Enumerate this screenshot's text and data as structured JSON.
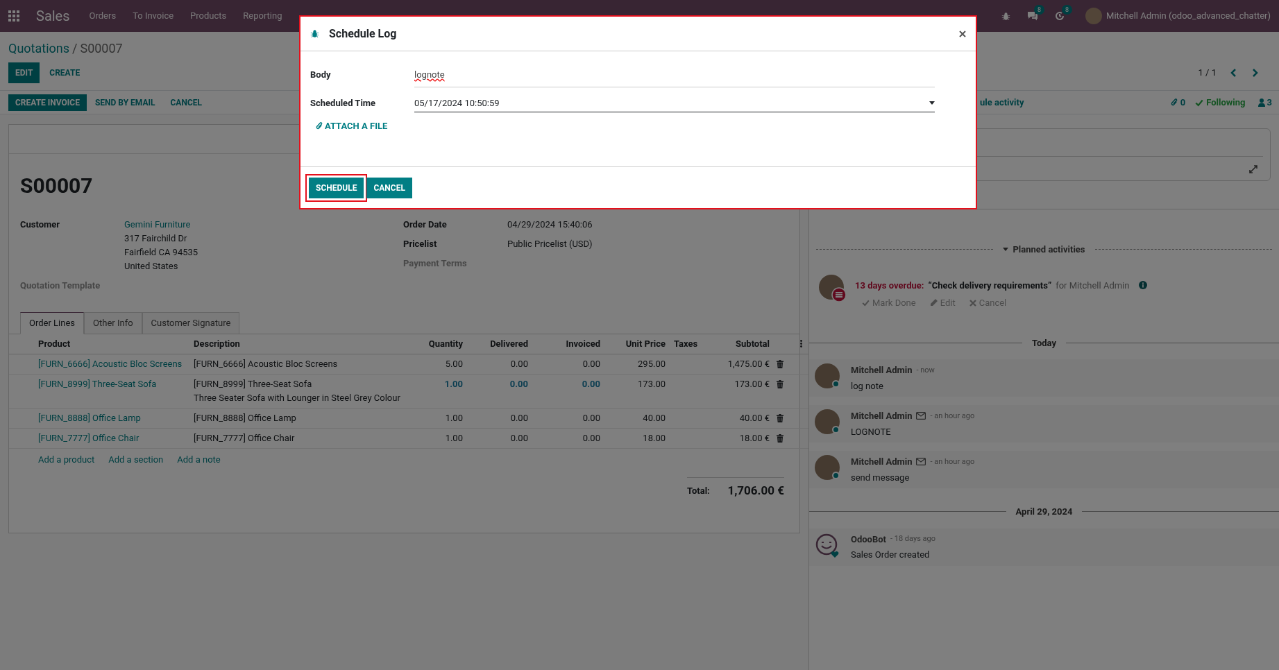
{
  "navbar": {
    "app": "Sales",
    "menu": [
      "Orders",
      "To Invoice",
      "Products",
      "Reporting"
    ],
    "chat_count": "8",
    "activity_count": "8",
    "user": "Mitchell Admin (odoo_advanced_chatter)"
  },
  "breadcrumb": {
    "parent": "Quotations",
    "separator": "/",
    "current": "S00007"
  },
  "actions": [
    "EDIT",
    "CREATE"
  ],
  "pager": "1 / 1",
  "status_actions": [
    {
      "label": "CREATE INVOICE",
      "primary": true
    },
    {
      "label": "SEND BY EMAIL",
      "primary": false
    },
    {
      "label": "CANCEL",
      "primary": false
    }
  ],
  "chatter_bar": {
    "partial_action": "ule activity",
    "attachments": "0",
    "follow": "Following",
    "followers": "3"
  },
  "form": {
    "name": "S00007",
    "left_fields": [
      {
        "label": "Customer",
        "link": "Gemini Furniture",
        "lines": [
          "317 Fairchild Dr",
          "Fairfield CA 94535",
          "United States"
        ]
      },
      {
        "label": "Quotation Template"
      }
    ],
    "right_fields": [
      {
        "label": "Order Date",
        "lines": [
          "04/29/2024 15:40:06"
        ]
      },
      {
        "label": "Pricelist",
        "lines": [
          "Public Pricelist (USD)"
        ]
      },
      {
        "label": "Payment Terms"
      }
    ],
    "tabs": [
      {
        "label": "Order Lines",
        "selected": true
      },
      {
        "label": "Other Info",
        "selected": false
      },
      {
        "label": "Customer Signature",
        "selected": false
      }
    ],
    "table": {
      "columns": [
        "Product",
        "Description",
        "Quantity",
        "Delivered",
        "Invoiced",
        "Unit Price",
        "Taxes",
        "Subtotal"
      ],
      "rows": [
        {
          "product": "[FURN_6666] Acoustic Bloc Screens",
          "description": [
            "[FURN_6666] Acoustic Bloc Screens"
          ],
          "quantity": "5.00",
          "delivered": "0.00",
          "invoiced": "0.00",
          "unit_price": "295.00",
          "subtotal": "1,475.00 €",
          "highlight": false
        },
        {
          "product": "[FURN_8999] Three-Seat Sofa",
          "description": [
            "[FURN_8999] Three-Seat Sofa",
            "Three Seater Sofa with Lounger in Steel Grey Colour"
          ],
          "quantity": "1.00",
          "delivered": "0.00",
          "invoiced": "0.00",
          "unit_price": "173.00",
          "subtotal": "173.00 €",
          "highlight": true
        },
        {
          "product": "[FURN_8888] Office Lamp",
          "description": [
            "[FURN_8888] Office Lamp"
          ],
          "quantity": "1.00",
          "delivered": "0.00",
          "invoiced": "0.00",
          "unit_price": "40.00",
          "subtotal": "40.00 €",
          "highlight": false
        },
        {
          "product": "[FURN_7777] Office Chair",
          "description": [
            "[FURN_7777] Office Chair"
          ],
          "quantity": "1.00",
          "delivered": "0.00",
          "invoiced": "0.00",
          "unit_price": "18.00",
          "subtotal": "18.00 €",
          "highlight": false
        }
      ],
      "add_links": [
        "Add a product",
        "Add a section",
        "Add a note"
      ]
    },
    "total": {
      "label": "Total:",
      "value": "1,706.00 €"
    }
  },
  "chatter": {
    "planned_title": "Planned activities",
    "activity": {
      "overdue": "13 days overdue:",
      "summary": "“Check delivery requirements”",
      "assignee": "for Mitchell Admin",
      "actions": [
        "Mark Done",
        "Edit",
        "Cancel"
      ]
    },
    "groups": [
      {
        "date": "Today",
        "messages": [
          {
            "author": "Mitchell Admin",
            "email": false,
            "time": "- now",
            "body": "log note",
            "kind": "user"
          },
          {
            "author": "Mitchell Admin",
            "email": true,
            "time": "- an hour ago",
            "body": "LOGNOTE",
            "kind": "user"
          },
          {
            "author": "Mitchell Admin",
            "email": true,
            "time": "- an hour ago",
            "body": "send message",
            "kind": "user"
          }
        ]
      },
      {
        "date": "April 29, 2024",
        "messages": [
          {
            "author": "OdooBot",
            "email": false,
            "time": "- 18 days ago",
            "body": "Sales Order created",
            "kind": "bot"
          }
        ]
      }
    ]
  },
  "modal": {
    "title": "Schedule Log",
    "outlined": true,
    "fields": [
      {
        "label": "Body",
        "value": "lognote",
        "kind": "text"
      },
      {
        "label": "Scheduled Time",
        "value": "05/17/2024 10:50:59",
        "kind": "datetime"
      }
    ],
    "attach": "ATTACH A FILE",
    "buttons": [
      {
        "label": "SCHEDULE",
        "highlighted": true
      },
      {
        "label": "CANCEL",
        "highlighted": false
      }
    ]
  }
}
